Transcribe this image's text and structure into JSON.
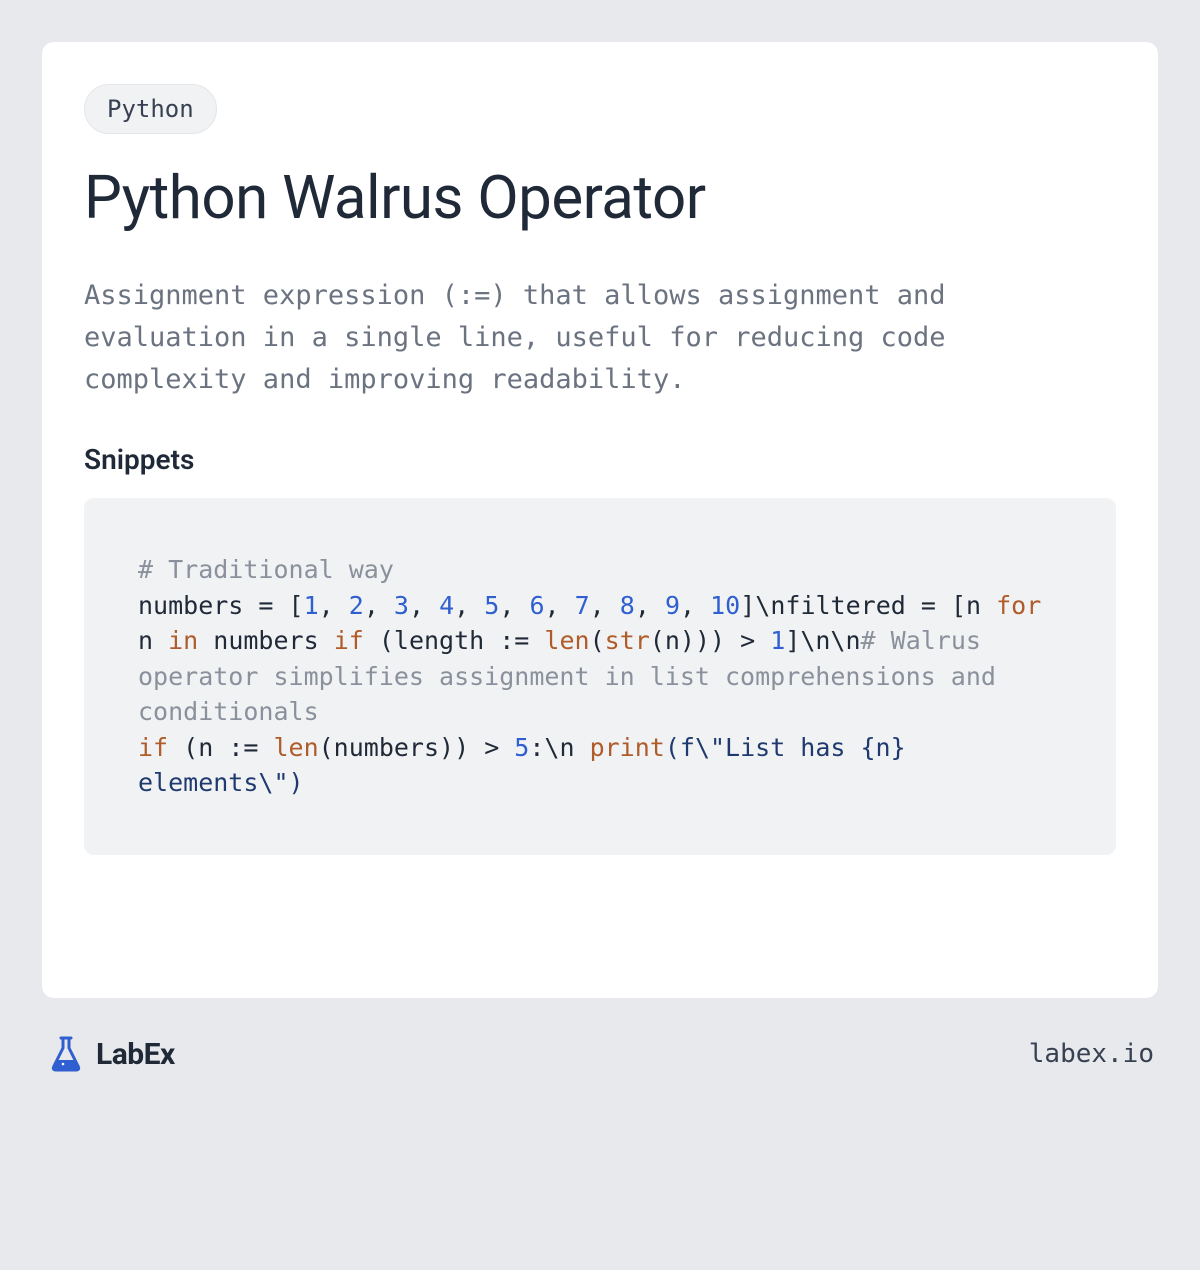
{
  "tag": "Python",
  "title": "Python Walrus Operator",
  "description": "Assignment expression (:=) that allows assignment and evaluation in a single line, useful for reducing code complexity and improving readability.",
  "snippets_heading": "Snippets",
  "code": {
    "comment1": "# Traditional way",
    "line2_a": "numbers = [",
    "nums": [
      "1",
      "2",
      "3",
      "4",
      "5",
      "6",
      "7",
      "8",
      "9",
      "10"
    ],
    "line2_b": "]\\nfiltered = [n ",
    "kw_for": "for",
    "line2_c": " n ",
    "kw_in": "in",
    "line2_d": " numbers ",
    "kw_if": "if",
    "line2_e": " (length := ",
    "fn_len": "len",
    "line2_f": "(",
    "fn_str": "str",
    "line2_g": "(n))) > ",
    "num_1": "1",
    "line2_h": "]\\n\\n",
    "comment2": "# Walrus operator simplifies assignment in list comprehensions and conditionals",
    "line3_a": "",
    "kw_if2": "if",
    "line3_b": " (n := ",
    "fn_len2": "len",
    "line3_c": "(numbers)) > ",
    "num_5": "5",
    "line3_d": ":\\n    ",
    "fn_print": "print",
    "line3_e": "(f\\\"List has {n} elements\\\")"
  },
  "brand": "LabEx",
  "footer_url": "labex.io"
}
